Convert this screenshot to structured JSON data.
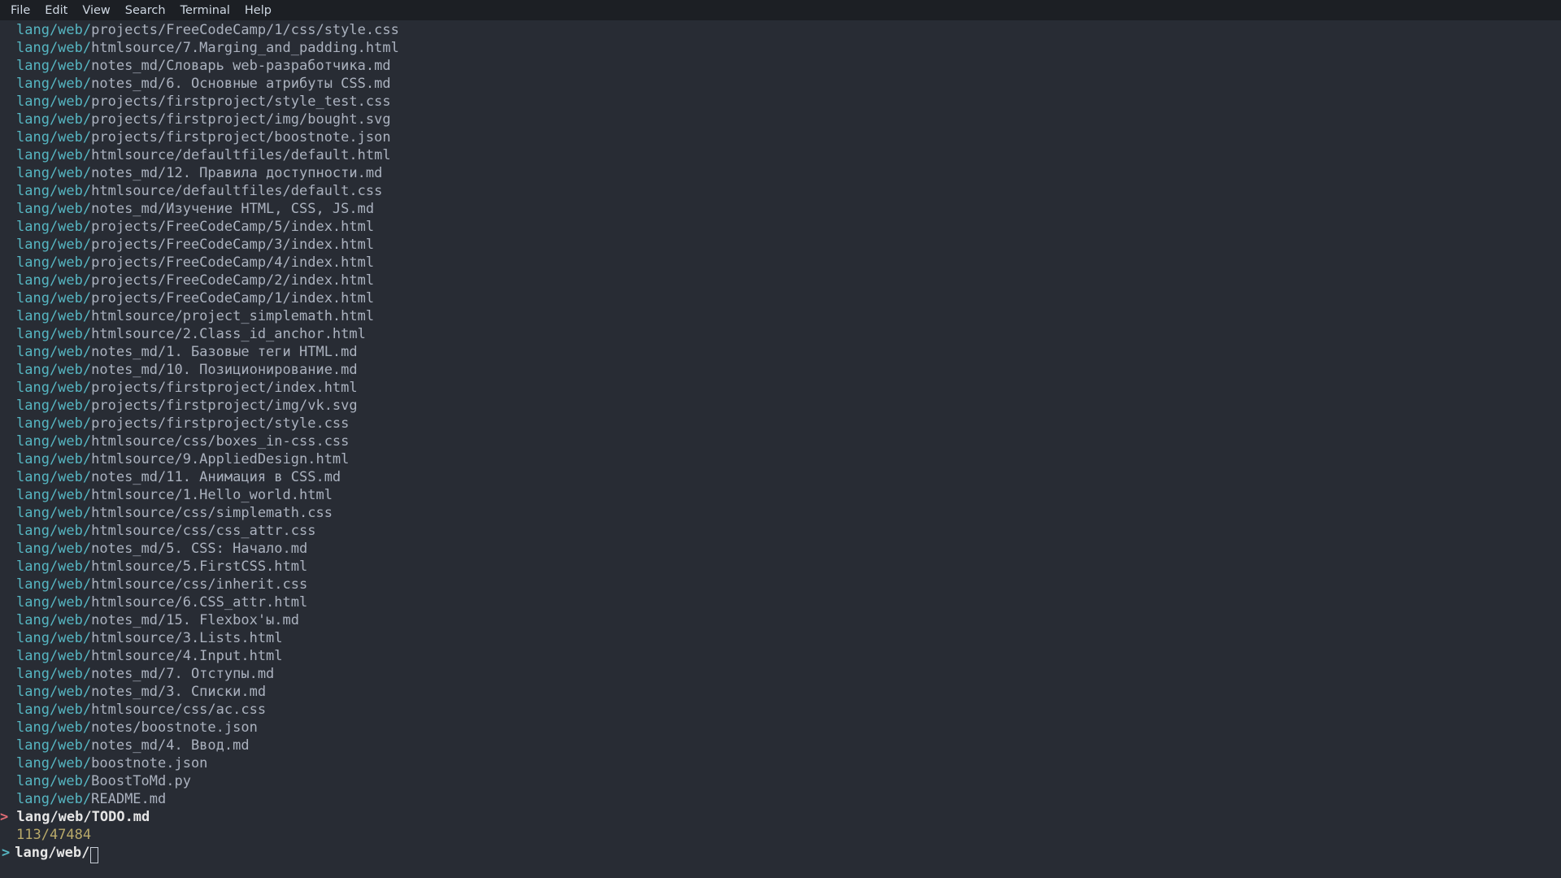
{
  "menubar": [
    "File",
    "Edit",
    "View",
    "Search",
    "Terminal",
    "Help"
  ],
  "common_prefix": "lang/web/",
  "results": [
    "projects/FreeCodeCamp/1/css/style.css",
    "htmlsource/7.Marging_and_padding.html",
    "notes_md/Словарь web-разработчика.md",
    "notes_md/6. Основные атрибуты CSS.md",
    "projects/firstproject/style_test.css",
    "projects/firstproject/img/bought.svg",
    "projects/firstproject/boostnote.json",
    "htmlsource/defaultfiles/default.html",
    "notes_md/12. Правила доступности.md",
    "htmlsource/defaultfiles/default.css",
    "notes_md/Изучение HTML, CSS, JS.md",
    "projects/FreeCodeCamp/5/index.html",
    "projects/FreeCodeCamp/3/index.html",
    "projects/FreeCodeCamp/4/index.html",
    "projects/FreeCodeCamp/2/index.html",
    "projects/FreeCodeCamp/1/index.html",
    "htmlsource/project_simplemath.html",
    "htmlsource/2.Class_id_anchor.html",
    "notes_md/1. Базовые теги HTML.md",
    "notes_md/10. Позиционирование.md",
    "projects/firstproject/index.html",
    "projects/firstproject/img/vk.svg",
    "projects/firstproject/style.css",
    "htmlsource/css/boxes_in-css.css",
    "htmlsource/9.AppliedDesign.html",
    "notes_md/11. Анимация в CSS.md",
    "htmlsource/1.Hello_world.html",
    "htmlsource/css/simplemath.css",
    "htmlsource/css/css_attr.css",
    "notes_md/5. CSS: Начало.md",
    "htmlsource/5.FirstCSS.html",
    "htmlsource/css/inherit.css",
    "htmlsource/6.CSS_attr.html",
    "notes_md/15. Flexbox'ы.md",
    "htmlsource/3.Lists.html",
    "htmlsource/4.Input.html",
    "notes_md/7. Отступы.md",
    "notes_md/3. Списки.md",
    "htmlsource/css/ac.css",
    "notes/boostnote.json",
    "notes_md/4. Ввод.md",
    "boostnote.json",
    "BoostToMd.py",
    "README.md"
  ],
  "selected": {
    "prefix": "lang/web/",
    "suffix": "TODO.md"
  },
  "count": "113/47484",
  "prompt": {
    "marker": ">",
    "text": "lang/web/"
  }
}
